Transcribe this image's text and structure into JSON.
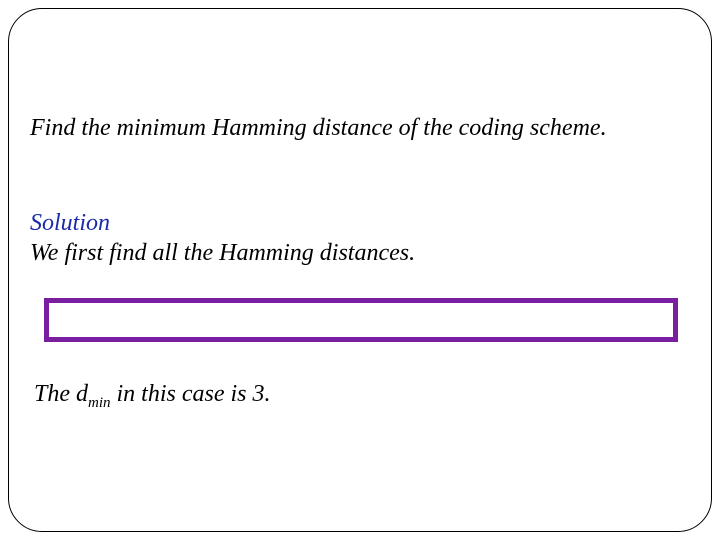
{
  "question": "Find the minimum Hamming distance of the coding scheme.",
  "solution": {
    "label": "Solution",
    "text": "We first find all the Hamming distances."
  },
  "conclusion": {
    "prefix": "The d",
    "sub": "min",
    "suffix": " in this case is 3."
  }
}
